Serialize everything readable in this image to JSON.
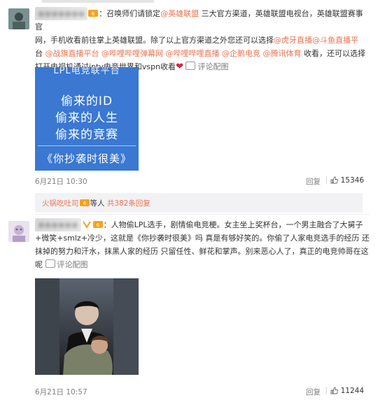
{
  "comment1": {
    "username": "●●●●●●●",
    "line1": "：召唤师们请锁定",
    "mention1": "@英雄联盟",
    "line1b": " 三大官方渠道，英雄联盟电视台，英雄联盟赛事官",
    "line2": "网，手机收看前往掌上英雄联盟。除了以上官方渠道之外您还可以选择",
    "mention2": "@虎牙直播",
    "mention3": "@斗鱼直播平",
    "line3a": "台 ",
    "mention4": "@战旗直播平台",
    "mention5": "@哔哩哔哩弹幕网",
    "mention6": "@哔哩哔哩直播",
    "mention7": "@企鹅电竞",
    "mention8": "@腾讯体育",
    "line3b": " 收看，还可以选择",
    "line4": "打开电视机通过iptv电竞世界和vspn收看",
    "heart": "❤",
    "media_link": "评论配图",
    "poster": {
      "top": "LPL电竞联平台",
      "line1": "偷来的ID",
      "line2": "偷来的人生",
      "line3": "偷来的竞赛",
      "line4": "《你抄袭时很美》"
    },
    "time": "6月21日 10:30",
    "reply": "回复",
    "likes": "15346"
  },
  "subreply": {
    "user": "火锅吃吐司",
    "mid": "等人",
    "count": "共382条回复"
  },
  "comment2": {
    "username": "●●●●●●",
    "line1": "：人物偷LPL选手，剧情偷电竞梗。女主坐上奖杯台，一个男主融合了大舅子",
    "line2": "+微笑+smlz+冷少，这就是《你抄袭时很美》吗 真是有够好笑的。你偷了人家电竞选手的经历 还",
    "line3": "抹掉的努力和汗水，抹黑人家的经历 只留任性、鲜花和掌声。别来恶心人了，真正的电竞帅哥在这",
    "line4": "呢 ",
    "media_link": "评论配图",
    "time": "6月21日 10:57",
    "reply": "回复",
    "likes": "11244"
  },
  "colors": {
    "link": "#eb7350",
    "poster": "#3a78d2",
    "meta": "#808080"
  }
}
